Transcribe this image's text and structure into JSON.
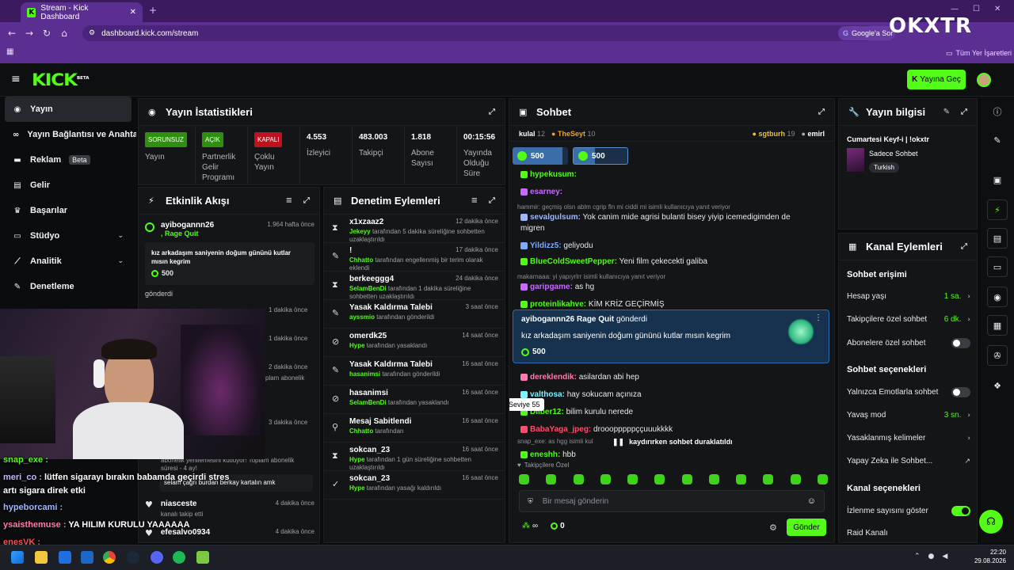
{
  "browser": {
    "tab_title": "Stream - Kick Dashboard",
    "url": "dashboard.kick.com/stream",
    "search_chip": "Google'a Sor",
    "bookmarks_label": "Tüm Yer İşaretleri",
    "watermark": "OKXTR"
  },
  "header": {
    "logo": "KICK",
    "logo_tag": "BETA",
    "go_live": "Yayına Geç"
  },
  "sidebar": {
    "items": [
      {
        "label": "Yayın",
        "icon": "broadcast-icon"
      },
      {
        "label": "Yayın Bağlantısı ve Anahtar",
        "icon": "link-icon"
      },
      {
        "label": "Reklam",
        "icon": "ad-icon",
        "badge": "Beta"
      },
      {
        "label": "Gelir",
        "icon": "wallet-icon"
      },
      {
        "label": "Başarılar",
        "icon": "trophy-icon"
      },
      {
        "label": "Stüdyo",
        "icon": "studio-icon"
      },
      {
        "label": "Analitik",
        "icon": "analytics-icon"
      },
      {
        "label": "Denetleme",
        "icon": "wrench-icon"
      }
    ]
  },
  "stats": {
    "title": "Yayın İstatistikleri",
    "cells": [
      {
        "badge": "SORUNSUZ",
        "label": "Yayın"
      },
      {
        "badge": "AÇIK",
        "label": "Partnerlik Gelir Programı"
      },
      {
        "badge": "KAPALI",
        "label": "Çoklu Yayın"
      },
      {
        "value": "4.553",
        "label": "İzleyici"
      },
      {
        "value": "483.003",
        "label": "Takipçi"
      },
      {
        "value": "1.818",
        "label": "Abone Sayısı"
      },
      {
        "value": "00:15:56",
        "label": "Yayında Olduğu Süre"
      }
    ]
  },
  "activity": {
    "title": "Etkinlik Akışı",
    "first": {
      "user": "ayibogannn26",
      "time": "1.964 hafta önce",
      "reward": ", Rage Quit",
      "message": "kız arkadaşım saniyenin doğum gününü kutlar mısın kegrim",
      "amount": "500",
      "footer": "gönderdi"
    },
    "times": [
      "1 dakika önce",
      "1 dakika önce",
      "2 dakika önce",
      "3 dakika önce"
    ],
    "partial": [
      "plam abonelik"
    ],
    "resub_text": "abonelik yenilemesini kutluyor! Toplam abonelik süresi - 4 ay!",
    "resub_msg": "selam çağrı burdan berkay kartalın amk",
    "follows": [
      {
        "user": "niasceste",
        "time": "4 dakika önce",
        "desc": "kanalı takip etti"
      },
      {
        "user": "efesalvo0934",
        "time": "4 dakika önce",
        "desc": ""
      }
    ]
  },
  "moderation": {
    "title": "Denetim Eylemleri",
    "rows": [
      {
        "icon": "hourglass-icon",
        "title": "x1xzaaz2",
        "time": "12 dakika önce",
        "actor": "Jekeyy",
        "desc": "tarafından 5 dakika süreliğine sohbetten uzaklaştırıldı"
      },
      {
        "icon": "edit-icon",
        "title": "!",
        "time": "17 dakika önce",
        "actor": "Chhatto",
        "desc": "tarafından engellenmiş bir terim olarak eklendi"
      },
      {
        "icon": "hourglass-icon",
        "title": "berkeeggg4",
        "time": "24 dakika önce",
        "actor": "SelamBenDi",
        "desc": "tarafından 1 dakika süreliğine sohbetten uzaklaştırıldı"
      },
      {
        "icon": "edit-icon",
        "title": "Yasak Kaldırma Talebi",
        "time": "3 saat önce",
        "actor": "ayssmio",
        "desc": "tarafından gönderildi"
      },
      {
        "icon": "ban-icon",
        "title": "omerdk25",
        "time": "14 saat önce",
        "actor": "Hype",
        "desc": "tarafından yasaklandı"
      },
      {
        "icon": "edit-icon",
        "title": "Yasak Kaldırma Talebi",
        "time": "16 saat önce",
        "actor": "hasanimsi",
        "desc": "tarafından gönderildi"
      },
      {
        "icon": "ban-icon",
        "title": "hasanimsi",
        "time": "16 saat önce",
        "actor": "SelamBenDi",
        "desc": "tarafından yasaklandı"
      },
      {
        "icon": "pin-icon",
        "title": "Mesaj Sabitlendi",
        "time": "16 saat önce",
        "actor": "Chhatto",
        "desc": "tarafından"
      },
      {
        "icon": "hourglass-icon",
        "title": "sokcan_23",
        "time": "16 saat önce",
        "actor": "Hype",
        "desc": "tarafından 1 gün süreliğine sohbetten uzaklaştırıldı"
      },
      {
        "icon": "unban-icon",
        "title": "sokcan_23",
        "time": "16 saat önce",
        "actor": "Hype",
        "desc": "tarafından yasağı kaldırıldı"
      }
    ]
  },
  "chat": {
    "title": "Sohbet",
    "leaderboard": [
      {
        "name": "kulal",
        "count": "12"
      },
      {
        "name": "TheSeyt",
        "count": "10"
      },
      {
        "name": "sgtburh",
        "count": "19"
      },
      {
        "name": "emirl",
        "count": ""
      }
    ],
    "goals": [
      "500",
      "500"
    ],
    "messages": [
      {
        "user": "hypekusum:",
        "text": "",
        "color": "#53fc18"
      },
      {
        "user": "esarney:",
        "text": "",
        "color": "#c56bff"
      },
      {
        "reply": "hammir: geçmiş olsn ablm cgrip fln mi ciddi mi isimli kullanıcıya yanıt veriyor"
      },
      {
        "user": "sevalgulsum:",
        "text": "Yok canim mide agrisi bulanti bisey yiyip icemedigimden de",
        "color": "#9fb7ff"
      },
      {
        "cont": "migren"
      },
      {
        "user": "Yildizz5:",
        "text": "geliyodu",
        "color": "#7fa8ff"
      },
      {
        "user": "BlueColdSweetPepper:",
        "text": "Yeni film çekecekti galiba",
        "color": "#53fc18"
      },
      {
        "reply": "makarnaaa: yi yapıyrlrr   isimli kullanıcıya yanıt veriyor"
      },
      {
        "user": "garipgame:",
        "text": "as hg",
        "color": "#c56bff"
      },
      {
        "user": "proteinlikahve:",
        "text": "KİM KRİZ GEÇİRMİŞ",
        "color": "#53fc18"
      }
    ],
    "pinned": {
      "user": "ayibogannn26",
      "reward": "Rage Quit",
      "sent": "gönderdi",
      "text": "kız arkadaşım saniyenin doğum gününü kutlar mısın kegrim",
      "amount": "500"
    },
    "messages2": [
      {
        "user": "dereklendik:",
        "text": "asilardan abi hep",
        "color": "#ff7ab0"
      },
      {
        "user": "valthosa:",
        "text": "hay sokucam açınıza",
        "color": "#7ff0ff"
      },
      {
        "user": "Dilber12:",
        "text": "bilim kurulu nerede",
        "color": "#53fc18"
      },
      {
        "user": "BabaYaga_jpeg:",
        "text": "drooopppppççuuukkkk",
        "color": "#ff4d6d"
      },
      {
        "reply": "snap_exe: as hgg isimli kul"
      },
      {
        "user": "eneshh:",
        "text": "hbb",
        "color": "#53fc18"
      }
    ],
    "tooltip": "Seviye 55",
    "paused": "kaydırırken sohbet duraklatıldı",
    "followers_only": "Takipçilere Özel",
    "input_placeholder": "Bir mesaj gönderin",
    "points_left": "∞",
    "points_right": "0",
    "send": "Gönder"
  },
  "info": {
    "title": "Yayın bilgisi",
    "stream_title": "Cumartesi Keyf-i | !okxtr",
    "category": "Sadece Sohbet",
    "tag": "Turkish"
  },
  "actions": {
    "title": "Kanal Eylemleri",
    "sec1": "Sohbet erişimi",
    "account_age": {
      "label": "Hesap yaşı",
      "value": "1 sa."
    },
    "followers_only": {
      "label": "Takipçilere özel sohbet",
      "value": "6 dk."
    },
    "subs_only": {
      "label": "Abonelere özel sohbet",
      "on": false
    },
    "sec2": "Sohbet seçenekleri",
    "emotes_only": {
      "label": "Yalnızca Emotlarla sohbet",
      "on": false
    },
    "slow_mode": {
      "label": "Yavaş mod",
      "value": "3 sn."
    },
    "banned_words": {
      "label": "Yasaklanmış kelimeler"
    },
    "ai": {
      "label": "Yapay Zeka ile Sohbet..."
    },
    "sec3": "Kanal seçenekleri",
    "show_viewers": {
      "label": "İzlenme sayısını göster",
      "on": true
    },
    "raid": {
      "label": "Raid Kanalı"
    }
  },
  "overlay_chat": [
    {
      "user": "snap_exe :",
      "text": "",
      "color": "#53fc18"
    },
    {
      "user": "meri_co :",
      "text": "lütfen sigarayı bırakın babamda geçirdi stres",
      "color": "#c8b3ff"
    },
    {
      "cont": "artı sigara direk etki"
    },
    {
      "user": "hypeborcami :",
      "text": "",
      "color": "#9fb7ff"
    },
    {
      "user": "ysaisthemuse :",
      "text": "YA HILIM KURULU YAAAAAA",
      "color": "#ff7ab0"
    },
    {
      "user": "enesVK :",
      "text": "",
      "color": "#ff4d4d"
    }
  ],
  "taskbar": {
    "time": "22:20",
    "date": "29.08.2026"
  }
}
